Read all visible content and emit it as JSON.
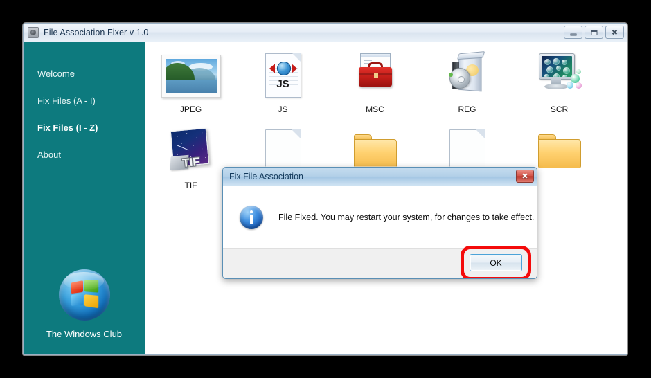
{
  "window": {
    "title": "File Association Fixer v 1.0",
    "icon": "app-icon",
    "controls": {
      "minimize": "minimize-icon",
      "maximize": "maximize-icon",
      "close": "close-icon"
    }
  },
  "sidebar": {
    "items": [
      {
        "label": "Welcome",
        "active": false
      },
      {
        "label": "Fix Files (A - I)",
        "active": false
      },
      {
        "label": "Fix Files (I - Z)",
        "active": true
      },
      {
        "label": "About",
        "active": false
      }
    ],
    "brand": {
      "label": "The Windows Club",
      "logo": "windows-orb-logo"
    },
    "color": "#0d7a7e"
  },
  "content": {
    "rows": [
      [
        {
          "label": "JPEG",
          "icon": "jpeg-photo-icon"
        },
        {
          "label": "JS",
          "icon": "js-script-document-icon"
        },
        {
          "label": "MSC",
          "icon": "msc-toolbox-icon"
        },
        {
          "label": "REG",
          "icon": "reg-software-box-icon"
        },
        {
          "label": "SCR",
          "icon": "scr-screensaver-monitor-icon"
        }
      ],
      [
        {
          "label": "TIF",
          "icon": "tif-image-icon"
        },
        {
          "label": "",
          "icon": "document-icon"
        },
        {
          "label": "",
          "icon": "folder-icon"
        },
        {
          "label": "",
          "icon": "document-icon"
        },
        {
          "label": "",
          "icon": "folder-icon"
        }
      ]
    ]
  },
  "dialog": {
    "title": "Fix File Association",
    "close_label": "✖",
    "icon": "info-icon",
    "message": "File Fixed. You may restart your system, for changes to take effect.",
    "ok_label": "OK",
    "highlight_color": "#f40b0b"
  }
}
